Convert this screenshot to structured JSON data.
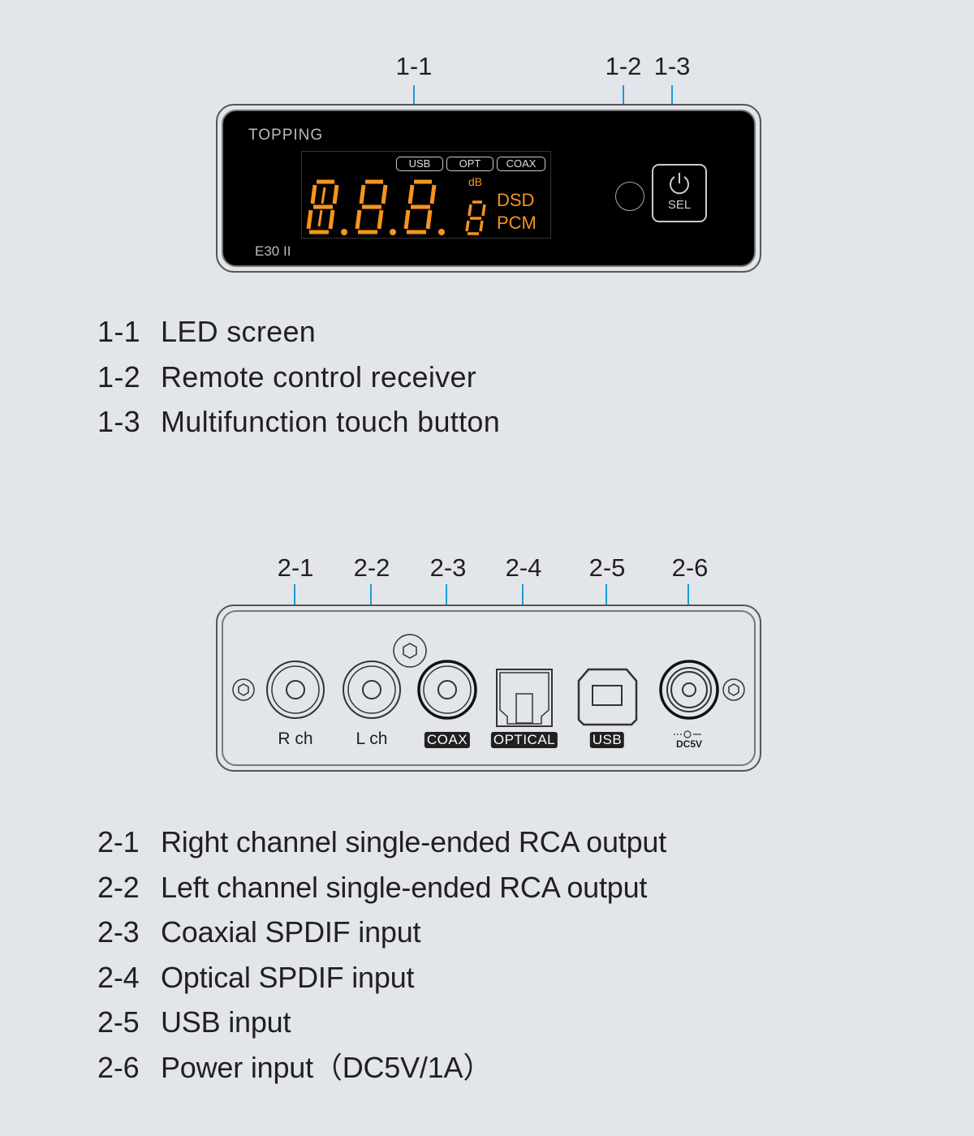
{
  "front_panel": {
    "brand": "TOPPING",
    "model": "E30 II",
    "input_tags": [
      "USB",
      "OPT",
      "COAX"
    ],
    "display_unit": "dB",
    "format_indicators": [
      "DSD",
      "PCM"
    ],
    "button_label": "SEL",
    "callouts": [
      "1-1",
      "1-2",
      "1-3"
    ],
    "colors": {
      "led": "#f7941d",
      "leader": "#1e9ad6",
      "panel": "#000000"
    }
  },
  "front_legend": [
    {
      "num": "1-1",
      "text": "LED screen"
    },
    {
      "num": "1-2",
      "text": "Remote control receiver"
    },
    {
      "num": "1-3",
      "text": "Multifunction touch button"
    }
  ],
  "rear_panel": {
    "callouts": [
      "2-1",
      "2-2",
      "2-3",
      "2-4",
      "2-5",
      "2-6"
    ],
    "port_labels": {
      "rch": "R ch",
      "lch": "L ch",
      "coax": "COAX",
      "optical": "OPTICAL",
      "usb": "USB",
      "dc": "DC5V"
    }
  },
  "rear_legend": [
    {
      "num": "2-1",
      "text": "Right channel single-ended RCA output"
    },
    {
      "num": "2-2",
      "text": "Left channel single-ended RCA output"
    },
    {
      "num": "2-3",
      "text": "Coaxial SPDIF input"
    },
    {
      "num": "2-4",
      "text": "Optical SPDIF input"
    },
    {
      "num": "2-5",
      "text": "USB input"
    },
    {
      "num": "2-6",
      "text": "Power input（DC5V/1A）"
    }
  ]
}
